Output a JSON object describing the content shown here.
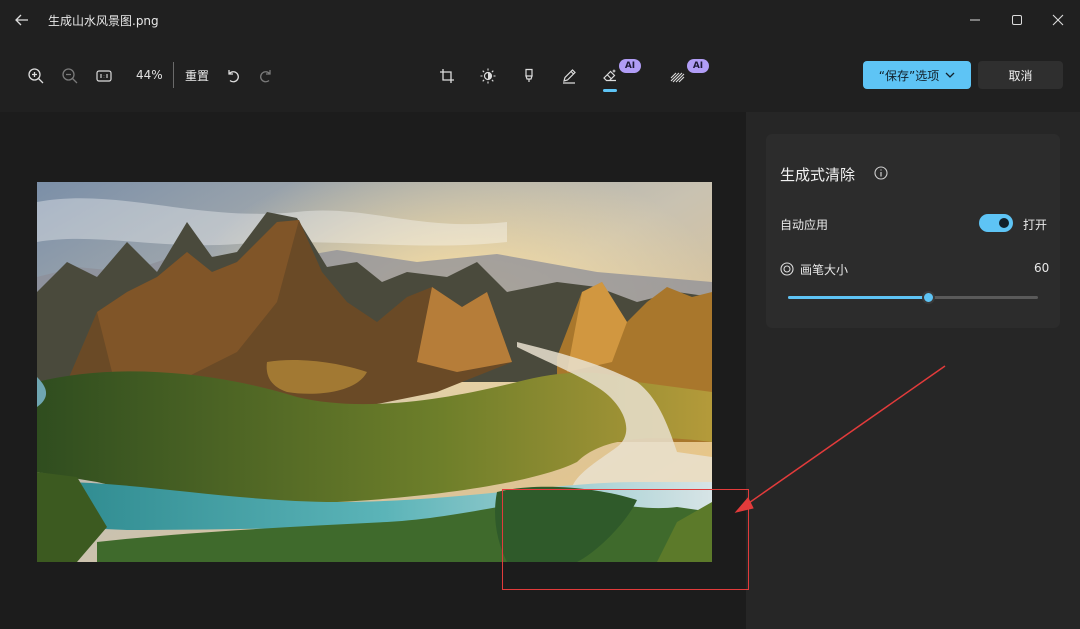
{
  "window": {
    "title": "生成山水风景图.png"
  },
  "toolbar": {
    "zoom_level": "44%",
    "reset_label": "重置",
    "ai_badge": "AI",
    "save_label": "“保存”选项",
    "cancel_label": "取消",
    "icons": [
      "zoom-in-icon",
      "zoom-out-icon",
      "actual-size-icon",
      "undo-icon",
      "redo-icon",
      "crop-icon",
      "brightness-icon",
      "markup-icon",
      "draw-icon",
      "generative-erase-icon",
      "background-blur-icon"
    ]
  },
  "panel": {
    "title": "生成式清除",
    "auto_apply_label": "自动应用",
    "auto_apply_state": "打开",
    "auto_apply_on": true,
    "brush_size_label": "画笔大小",
    "brush_size_value": "60",
    "brush_size_fraction": 0.56
  },
  "colors": {
    "accent": "#5ec4f5",
    "ai_badge": "#b19df6",
    "annotation_red": "#e23b3b"
  }
}
